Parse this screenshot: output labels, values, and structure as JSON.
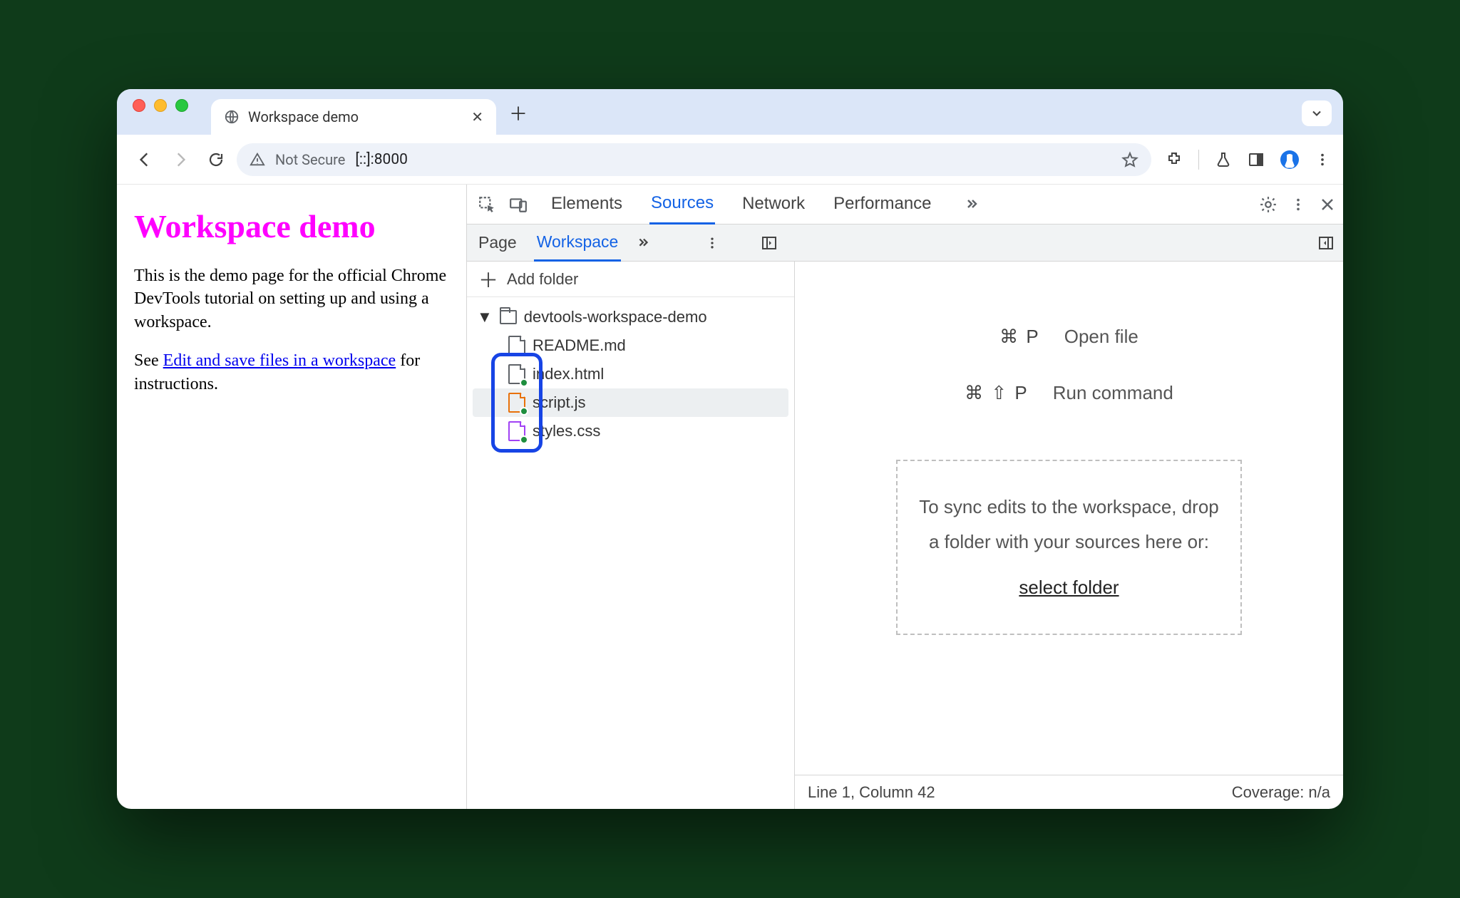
{
  "browser": {
    "tab_title": "Workspace demo",
    "not_secure": "Not Secure",
    "url": "[::]:8000"
  },
  "page": {
    "heading": "Workspace demo",
    "para1": "This is the demo page for the official Chrome DevTools tutorial on setting up and using a workspace.",
    "see": "See ",
    "link": "Edit and save files in a workspace",
    "after_link": " for instructions."
  },
  "devtools": {
    "top_tabs": {
      "elements": "Elements",
      "sources": "Sources",
      "network": "Network",
      "performance": "Performance"
    },
    "sub_tabs": {
      "page": "Page",
      "workspace": "Workspace"
    },
    "add_folder": "Add folder",
    "folder": "devtools-workspace-demo",
    "files": {
      "readme": "README.md",
      "index": "index.html",
      "script": "script.js",
      "styles": "styles.css"
    },
    "hints": {
      "open_keys": "⌘ P",
      "open_label": "Open file",
      "cmd_keys": "⌘ ⇧ P",
      "cmd_label": "Run command"
    },
    "drop": {
      "line1": "To sync edits to the workspace, drop",
      "line2": "a folder with your sources here or:",
      "link": "select folder"
    },
    "status": {
      "pos": "Line 1, Column 42",
      "coverage": "Coverage: n/a"
    }
  }
}
